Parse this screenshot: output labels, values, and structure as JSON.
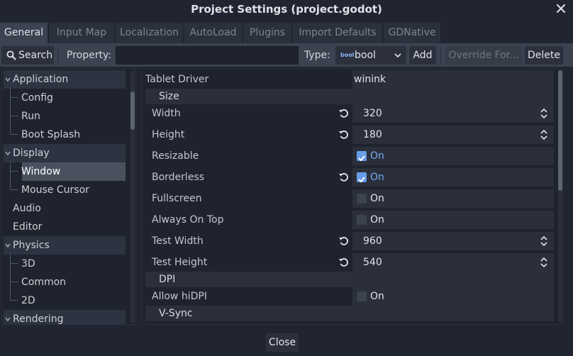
{
  "window": {
    "title": "Project Settings (project.godot)",
    "close_icon": "close-icon"
  },
  "tabs": [
    {
      "label": "General",
      "active": true
    },
    {
      "label": "Input Map"
    },
    {
      "label": "Localization"
    },
    {
      "label": "AutoLoad"
    },
    {
      "label": "Plugins"
    },
    {
      "label": "Import Defaults"
    },
    {
      "label": "GDNative"
    }
  ],
  "toolbar": {
    "search_label": "Search",
    "property_label": "Property:",
    "property_value": "",
    "type_label": "Type:",
    "type_value": "bool",
    "add_label": "Add",
    "override_label": "Override For...",
    "delete_label": "Delete"
  },
  "tree": {
    "items": [
      {
        "label": "Application",
        "kind": "section"
      },
      {
        "label": "Config"
      },
      {
        "label": "Run"
      },
      {
        "label": "Boot Splash"
      },
      {
        "label": "Display",
        "kind": "section"
      },
      {
        "label": "Window",
        "selected": true
      },
      {
        "label": "Mouse Cursor"
      },
      {
        "label": "Audio",
        "kind": "plain"
      },
      {
        "label": "Editor",
        "kind": "plain"
      },
      {
        "label": "Physics",
        "kind": "section"
      },
      {
        "label": "3D"
      },
      {
        "label": "Common"
      },
      {
        "label": "2D"
      },
      {
        "label": "Rendering",
        "kind": "section"
      }
    ]
  },
  "inspector": {
    "tablet_driver_label": "Tablet Driver",
    "tablet_driver_value": "winink",
    "cat_size": "Size",
    "width_label": "Width",
    "width_value": "320",
    "height_label": "Height",
    "height_value": "180",
    "resizable_label": "Resizable",
    "borderless_label": "Borderless",
    "fullscreen_label": "Fullscreen",
    "always_on_top_label": "Always On Top",
    "test_width_label": "Test Width",
    "test_width_value": "960",
    "test_height_label": "Test Height",
    "test_height_value": "540",
    "cat_dpi": "DPI",
    "allow_hidpi_label": "Allow hiDPI",
    "cat_vsync": "V-Sync",
    "on_text": "On"
  },
  "footer": {
    "close_label": "Close"
  },
  "colors": {
    "accent": "#689de8",
    "background": "#202531",
    "panel": "#3b4250"
  }
}
